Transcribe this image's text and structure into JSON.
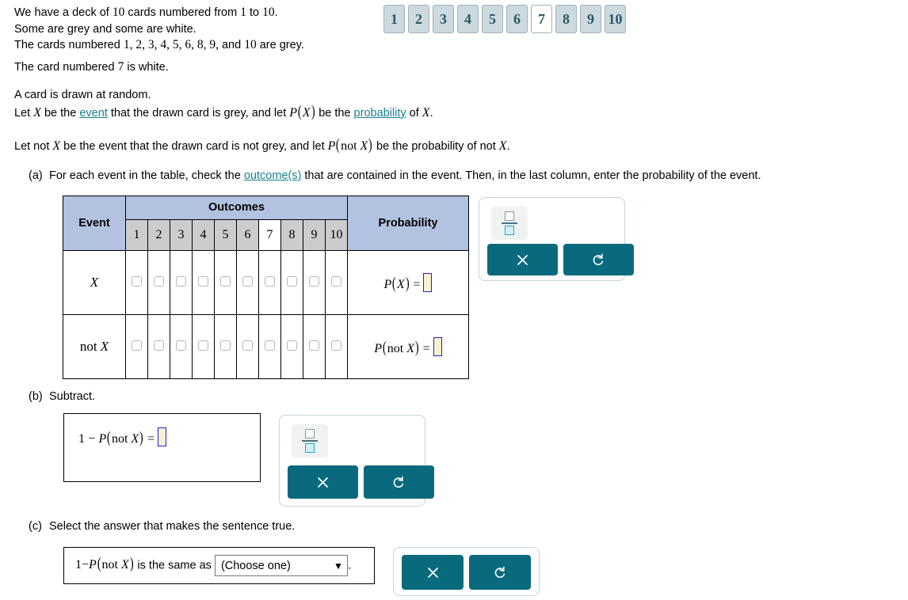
{
  "intro": {
    "line1_a": "We have a deck of ",
    "line1_n1": "10",
    "line1_b": " cards numbered from ",
    "line1_n2": "1",
    "line1_c": " to ",
    "line1_n3": "10",
    "line1_d": ".",
    "line2": "Some are grey and some are white.",
    "line3_a": "The cards numbered ",
    "line3_nums": "1, 2, 3, 4, 5, 6, 8, 9,",
    "line3_b": " and ",
    "line3_n10": "10",
    "line3_c": " are grey.",
    "line4_a": "The card numbered ",
    "line4_n": "7",
    "line4_b": " is white."
  },
  "cards": [
    {
      "label": "1",
      "color": "grey"
    },
    {
      "label": "2",
      "color": "grey"
    },
    {
      "label": "3",
      "color": "grey"
    },
    {
      "label": "4",
      "color": "grey"
    },
    {
      "label": "5",
      "color": "grey"
    },
    {
      "label": "6",
      "color": "grey"
    },
    {
      "label": "7",
      "color": "white"
    },
    {
      "label": "8",
      "color": "grey"
    },
    {
      "label": "9",
      "color": "grey"
    },
    {
      "label": "10",
      "color": "grey"
    }
  ],
  "block2": {
    "line1": "A card is drawn at random.",
    "l2_a": "Let ",
    "l2_X": "X",
    "l2_b": " be the ",
    "l2_link1": "event",
    "l2_c": " that the drawn card is grey, and let ",
    "l2_P": "P",
    "l2_PX": "X",
    "l2_d": " be the ",
    "l2_link2": "probability",
    "l2_e": " of ",
    "l2_X2": "X",
    "l2_f": ".",
    "l3_a": "Let not ",
    "l3_X": "X",
    "l3_b": " be the event that the drawn card is not grey, and let ",
    "l3_P": "P",
    "l3_not": "not ",
    "l3_X2": "X",
    "l3_c": " be the probability of not ",
    "l3_X3": "X",
    "l3_d": "."
  },
  "parts": {
    "a_tag": "(a)",
    "a_text_1": "For each event in the table, check the ",
    "a_link": "outcome(s)",
    "a_text_2": " that are contained in the event. Then, in the last column, enter the probability of the event.",
    "b_tag": "(b)",
    "b_text": "Subtract.",
    "c_tag": "(c)",
    "c_text": "Select the answer that makes the sentence true."
  },
  "table": {
    "header_event": "Event",
    "header_outcomes": "Outcomes",
    "header_probability": "Probability",
    "outcome_numbers": [
      {
        "label": "1",
        "color": "grey"
      },
      {
        "label": "2",
        "color": "grey"
      },
      {
        "label": "3",
        "color": "grey"
      },
      {
        "label": "4",
        "color": "grey"
      },
      {
        "label": "5",
        "color": "grey"
      },
      {
        "label": "6",
        "color": "grey"
      },
      {
        "label": "7",
        "color": "white"
      },
      {
        "label": "8",
        "color": "grey"
      },
      {
        "label": "9",
        "color": "grey"
      },
      {
        "label": "10",
        "color": "grey"
      }
    ],
    "rows": [
      {
        "event_label": "X",
        "event_style": "italic",
        "prob_P": "P",
        "prob_arg": "X",
        "prob_arg_style": "italic",
        "prob_equals": "=",
        "prob_value": "",
        "checkboxes": [
          false,
          false,
          false,
          false,
          false,
          false,
          false,
          false,
          false,
          false
        ]
      },
      {
        "event_label_prefix": "not ",
        "event_label": "X",
        "event_style": "italic",
        "prob_P": "P",
        "prob_arg_prefix": "not ",
        "prob_arg": "X",
        "prob_arg_style": "italic",
        "prob_equals": "=",
        "prob_value": "",
        "checkboxes": [
          false,
          false,
          false,
          false,
          false,
          false,
          false,
          false,
          false,
          false
        ]
      }
    ]
  },
  "part_b": {
    "expr_one": "1",
    "expr_minus": "−",
    "expr_P": "P",
    "expr_not": "not ",
    "expr_X": "X",
    "expr_equals": "=",
    "expr_value": ""
  },
  "part_c": {
    "expr_one": "1",
    "expr_minus": "−",
    "expr_P": "P",
    "expr_not": "not ",
    "expr_X": "X",
    "sentence": " is the same as ",
    "select_value": "(Choose one)",
    "caret": "▼",
    "period": "."
  },
  "widgets": {
    "fraction_icon": "fraction-icon",
    "clear_icon": "x-icon",
    "undo_icon": "undo-icon"
  },
  "colors": {
    "teal_button": "#0a6a7d",
    "link": "#17808f",
    "header_blue": "#b2c2e0",
    "card_grey": "#ccd9de",
    "cell_grey": "#cccccc",
    "input_fill": "#f7f2cf",
    "input_border": "#2222cc"
  }
}
